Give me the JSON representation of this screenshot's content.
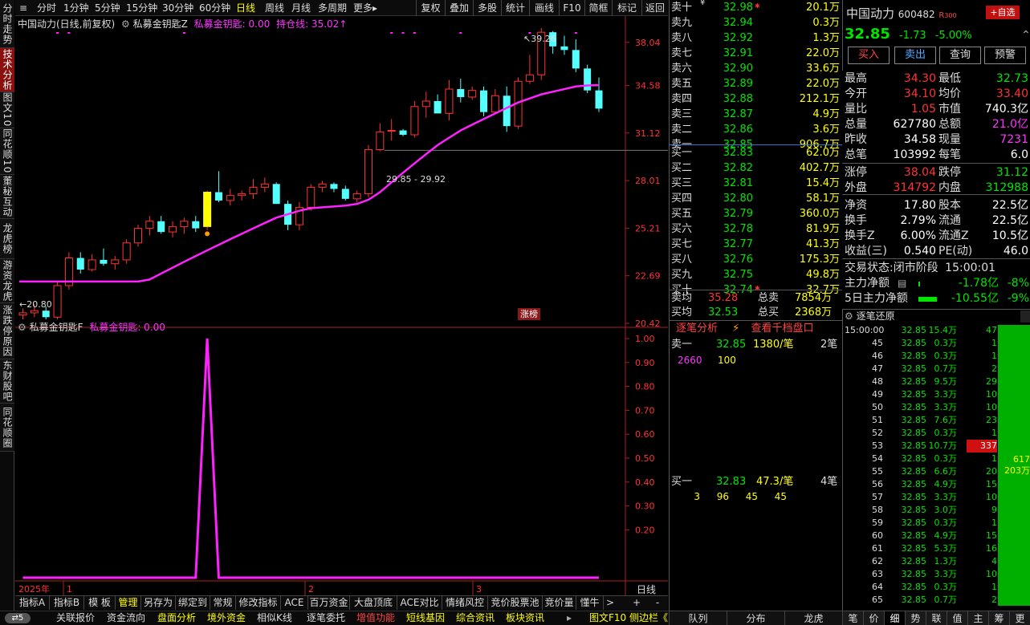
{
  "colors": {
    "up": "#ff3333",
    "down": "#54ffff",
    "ma": "#ff22ff",
    "accent": "#ffff00"
  },
  "side_tabs": [
    {
      "label": "分时走势",
      "active": false
    },
    {
      "label": "技术分析",
      "active": true
    },
    {
      "label": "图文10",
      "active": false
    },
    {
      "label": "同花顺10",
      "active": false
    },
    {
      "label": "董秘互动",
      "active": false
    },
    {
      "label": "龙虎榜",
      "active": false
    },
    {
      "label": "游资龙虎",
      "active": false
    },
    {
      "label": "涨跌停原因",
      "active": false
    },
    {
      "label": "东财股吧",
      "active": false
    },
    {
      "label": "同花顺圈",
      "active": false
    }
  ],
  "periods": [
    "分时",
    "1分钟",
    "5分钟",
    "15分钟",
    "30分钟",
    "60分钟",
    "日线",
    "周线",
    "月线",
    "多周期",
    "更多▸"
  ],
  "active_period": "日线",
  "tools": [
    "复权",
    "叠加",
    "多股",
    "统计",
    "画线",
    "F10",
    "简框",
    "标记",
    "返回"
  ],
  "chart": {
    "title": "中国动力(日线,前复权)",
    "indicator_name": "私募金钥匙Z",
    "indicator_value": "私募金钥匙: 0.00",
    "hold_line": "持仓线: 35.02↑",
    "high_label": "39.26",
    "low_label": "20.80",
    "range_label": "29.85 - 29.92",
    "zhangting_badge": "涨榜",
    "yticks": [
      "38.04",
      "34.58",
      "31.12",
      "28.01",
      "25.21",
      "22.69",
      "20.42"
    ],
    "sub_title": "私募金钥匙F",
    "sub_value": "私募金钥匙: 0.00",
    "sub_yticks": [
      "1.00",
      "0.90",
      "0.80",
      "0.70",
      "0.60",
      "0.50",
      "0.40",
      "0.30",
      "0.20"
    ],
    "xlabels": [
      "2025年",
      "1",
      "2",
      "3"
    ],
    "period_label": "日线"
  },
  "chart_data": {
    "type": "candlestick",
    "ohlc": [
      [
        20.8,
        21.1,
        20.6,
        20.9
      ],
      [
        20.9,
        21.3,
        20.7,
        21.0
      ],
      [
        21.0,
        21.2,
        20.6,
        20.7
      ],
      [
        20.7,
        22.4,
        20.6,
        22.2
      ],
      [
        22.2,
        23.9,
        22.0,
        23.6
      ],
      [
        23.6,
        23.9,
        22.8,
        23.0
      ],
      [
        23.0,
        23.8,
        22.9,
        23.5
      ],
      [
        23.5,
        24.1,
        23.2,
        23.3
      ],
      [
        23.3,
        23.7,
        23.0,
        23.5
      ],
      [
        23.5,
        24.6,
        23.3,
        24.4
      ],
      [
        24.4,
        25.4,
        24.2,
        25.2
      ],
      [
        25.2,
        25.9,
        24.8,
        25.6
      ],
      [
        25.6,
        25.9,
        24.9,
        25.0
      ],
      [
        25.0,
        25.6,
        24.7,
        25.3
      ],
      [
        25.3,
        25.8,
        24.9,
        25.6
      ],
      [
        25.6,
        25.9,
        25.0,
        25.2
      ],
      [
        25.3,
        27.4,
        25.1,
        27.3
      ],
      [
        27.3,
        28.6,
        26.7,
        26.8
      ],
      [
        26.8,
        27.5,
        26.5,
        27.1
      ],
      [
        27.1,
        27.4,
        26.8,
        27.2
      ],
      [
        27.2,
        28.1,
        26.9,
        27.6
      ],
      [
        27.6,
        28.2,
        27.3,
        27.8
      ],
      [
        27.8,
        27.9,
        26.6,
        26.6
      ],
      [
        26.6,
        26.8,
        25.1,
        25.4
      ],
      [
        25.4,
        26.7,
        25.1,
        26.4
      ],
      [
        26.4,
        27.8,
        26.2,
        27.6
      ],
      [
        27.6,
        28.0,
        27.3,
        27.8
      ],
      [
        27.8,
        27.9,
        27.3,
        27.5
      ],
      [
        27.5,
        27.7,
        26.8,
        26.9
      ],
      [
        26.9,
        27.4,
        26.7,
        27.2
      ],
      [
        27.2,
        30.3,
        27.0,
        30.0
      ],
      [
        30.0,
        31.8,
        29.9,
        31.2
      ],
      [
        31.3,
        32.1,
        30.6,
        31.3
      ],
      [
        31.3,
        31.4,
        30.9,
        31.0
      ],
      [
        31.0,
        33.4,
        30.8,
        33.0
      ],
      [
        33.0,
        34.1,
        32.2,
        33.4
      ],
      [
        33.4,
        33.9,
        32.6,
        32.5
      ],
      [
        32.5,
        35.0,
        32.0,
        34.3
      ],
      [
        34.3,
        35.1,
        33.3,
        33.7
      ],
      [
        33.7,
        34.5,
        33.5,
        34.2
      ],
      [
        34.2,
        34.5,
        32.3,
        32.6
      ],
      [
        32.6,
        34.3,
        32.5,
        33.8
      ],
      [
        33.8,
        34.5,
        31.2,
        31.6
      ],
      [
        31.6,
        35.2,
        31.4,
        34.9
      ],
      [
        34.9,
        37.0,
        34.7,
        35.4
      ],
      [
        35.4,
        39.26,
        35.0,
        38.9
      ],
      [
        38.9,
        39.0,
        37.1,
        37.7
      ],
      [
        37.7,
        38.6,
        37.0,
        37.4
      ],
      [
        37.4,
        38.3,
        35.6,
        35.9
      ],
      [
        35.9,
        36.2,
        34.0,
        34.2
      ],
      [
        34.2,
        35.2,
        32.6,
        32.85
      ]
    ],
    "ma": [
      22.4,
      22.4,
      22.4,
      22.4,
      22.4,
      22.4,
      22.4,
      22.4,
      22.4,
      22.4,
      22.4,
      22.5,
      22.8,
      23.1,
      23.4,
      23.7,
      24.0,
      24.3,
      24.6,
      24.9,
      25.2,
      25.5,
      25.8,
      26.0,
      26.2,
      26.35,
      26.4,
      26.45,
      26.5,
      26.6,
      26.85,
      27.3,
      27.9,
      28.5,
      29.1,
      29.7,
      30.3,
      30.8,
      31.3,
      31.7,
      32.1,
      32.5,
      32.9,
      33.3,
      33.6,
      33.9,
      34.1,
      34.3,
      34.5,
      34.58,
      34.6
    ],
    "signal": [
      0,
      0,
      0,
      0,
      0,
      0,
      0,
      0,
      0,
      0,
      0,
      0,
      0,
      0,
      0,
      0,
      1,
      0,
      0,
      0,
      0,
      0,
      0,
      0,
      0,
      0,
      0,
      0,
      0,
      0,
      0,
      0,
      0,
      0,
      0,
      0,
      0,
      0,
      0,
      0,
      0,
      0,
      0,
      0,
      0,
      0,
      0,
      0,
      0,
      0,
      0
    ],
    "ylim": [
      20.42,
      39.26
    ],
    "x_labels": [
      "2025年",
      "1",
      "2",
      "3"
    ]
  },
  "stock": {
    "name": "中国动力",
    "code": "600482",
    "r_tag": "R",
    "r_value": "300",
    "add_label": "+自选",
    "price": "32.85",
    "change": "-1.73",
    "pct": "-5.00%"
  },
  "actions": [
    "买入",
    "卖出",
    "查询",
    "预警"
  ],
  "sells": [
    {
      "label": "卖十",
      "tag": "¥",
      "price": "32.98",
      "vol": "20.1万",
      "star": true
    },
    {
      "label": "卖九",
      "price": "32.94",
      "vol": "0.3万"
    },
    {
      "label": "卖八",
      "price": "32.92",
      "vol": "1.3万"
    },
    {
      "label": "卖七",
      "price": "32.91",
      "vol": "22.0万"
    },
    {
      "label": "卖六",
      "price": "32.90",
      "vol": "33.6万"
    },
    {
      "label": "卖五",
      "price": "32.89",
      "vol": "22.0万"
    },
    {
      "label": "卖四",
      "price": "32.88",
      "vol": "212.1万"
    },
    {
      "label": "卖三",
      "price": "32.87",
      "vol": "4.9万"
    },
    {
      "label": "卖二",
      "price": "32.86",
      "vol": "3.6万"
    },
    {
      "label": "卖一",
      "price": "32.85",
      "vol": "906.7万"
    }
  ],
  "buys": [
    {
      "label": "买一",
      "price": "32.83",
      "vol": "62.0万"
    },
    {
      "label": "买二",
      "price": "32.82",
      "vol": "402.7万"
    },
    {
      "label": "买三",
      "price": "32.81",
      "vol": "15.4万"
    },
    {
      "label": "买四",
      "price": "32.80",
      "vol": "58.1万"
    },
    {
      "label": "买五",
      "price": "32.79",
      "vol": "360.0万"
    },
    {
      "label": "买六",
      "price": "32.78",
      "vol": "81.9万"
    },
    {
      "label": "买七",
      "price": "32.77",
      "vol": "41.3万"
    },
    {
      "label": "买八",
      "price": "32.76",
      "vol": "175.3万"
    },
    {
      "label": "买九",
      "price": "32.75",
      "vol": "49.8万"
    },
    {
      "label": "买十",
      "price": "32.74",
      "vol": "32.7万",
      "star": true
    }
  ],
  "avg": {
    "sell_label": "卖均",
    "sell_price": "35.28",
    "sell_total_label": "总卖",
    "sell_total": "7854万",
    "buy_label": "买均",
    "buy_price": "32.53",
    "buy_total_label": "总买",
    "buy_total": "2368万"
  },
  "quote": [
    {
      "k1": "最高",
      "v1": "34.30",
      "c1": "red",
      "k2": "最低",
      "v2": "32.73",
      "c2": "green"
    },
    {
      "k1": "今开",
      "v1": "34.10",
      "c1": "red",
      "k2": "均价",
      "v2": "33.40",
      "c2": "red"
    },
    {
      "k1": "量比",
      "v1": "1.05",
      "c1": "red",
      "k2": "市值",
      "v2": "740.3亿",
      "c2": "wht"
    },
    {
      "k1": "总量",
      "v1": "627780",
      "c1": "wht",
      "k2": "总额",
      "v2": "21.0亿",
      "c2": "mag"
    },
    {
      "k1": "昨收",
      "v1": "34.58",
      "c1": "wht",
      "k2": "现量",
      "v2": "7231",
      "c2": "mag"
    },
    {
      "k1": "总笔",
      "v1": "103992",
      "c1": "wht",
      "k2": "每笔",
      "v2": "6.0",
      "c2": "wht"
    },
    {
      "k1": "涨停",
      "v1": "38.04",
      "c1": "red",
      "k2": "跌停",
      "v2": "31.12",
      "c2": "green"
    },
    {
      "k1": "外盘",
      "v1": "314792",
      "c1": "red",
      "k2": "内盘",
      "v2": "312988",
      "c2": "green"
    },
    {
      "k1": "净资",
      "v1": "17.80",
      "c1": "wht",
      "k2": "股本",
      "v2": "22.5亿",
      "c2": "wht"
    },
    {
      "k1": "换手",
      "v1": "2.79%",
      "c1": "wht",
      "k2": "流通",
      "v2": "22.5亿",
      "c2": "wht"
    },
    {
      "k1": "换手Z",
      "v1": "6.00%",
      "c1": "wht",
      "k2": "流通Z",
      "v2": "10.5亿",
      "c2": "wht"
    },
    {
      "k1": "收益(三)",
      "v1": "0.540",
      "c1": "wht",
      "k2": "PE(动)",
      "v2": "46.0",
      "c2": "wht"
    }
  ],
  "trade_status": {
    "label": "交易状态:",
    "value": "闭市阶段",
    "time": "15:00:01"
  },
  "flow": [
    {
      "label": "主力净额",
      "value": "-1.78亿",
      "pct": "-8%",
      "bar": 0.03
    },
    {
      "label": "5日主力净额",
      "value": "-10.55亿",
      "pct": "-9%",
      "bar": 0.35
    }
  ],
  "zhubi": {
    "title": "逐笔分析",
    "lightning": "⚡",
    "link": "查看千档盘口",
    "sell_row": {
      "label": "卖一",
      "price": "32.85",
      "qty": "1380/笔",
      "count": "2笔"
    },
    "sell_orders": [
      "2660",
      "100"
    ],
    "buy_row": {
      "label": "买一",
      "price": "32.83",
      "qty": "47.3/笔",
      "count": "4笔"
    },
    "buy_orders": [
      "3",
      "96",
      "45",
      "45"
    ]
  },
  "ticks_title": "逐笔还原",
  "ticks": [
    {
      "t": "15:00:00",
      "p": "32.85",
      "v": "15.4万",
      "n": "47"
    },
    {
      "t": "45",
      "p": "32.85",
      "v": "0.3万",
      "n": "1"
    },
    {
      "t": "46",
      "p": "32.85",
      "v": "0.3万",
      "n": "1"
    },
    {
      "t": "47",
      "p": "32.85",
      "v": "0.7万",
      "n": "2"
    },
    {
      "t": "48",
      "p": "32.85",
      "v": "9.5万",
      "n": "29"
    },
    {
      "t": "49",
      "p": "32.85",
      "v": "3.3万",
      "n": "10"
    },
    {
      "t": "50",
      "p": "32.85",
      "v": "3.3万",
      "n": "10"
    },
    {
      "t": "51",
      "p": "32.85",
      "v": "7.6万",
      "n": "23"
    },
    {
      "t": "52",
      "p": "32.85",
      "v": "0.3万",
      "n": "1"
    },
    {
      "t": "53",
      "p": "32.85",
      "v": "10.7万",
      "n": "337",
      "highlight": true
    },
    {
      "t": "54",
      "p": "32.85",
      "v": "0.3万",
      "n": "1"
    },
    {
      "t": "55",
      "p": "32.85",
      "v": "6.6万",
      "n": "20"
    },
    {
      "t": "56",
      "p": "32.85",
      "v": "4.9万",
      "n": "15"
    },
    {
      "t": "57",
      "p": "32.85",
      "v": "3.3万",
      "n": "10"
    },
    {
      "t": "58",
      "p": "32.85",
      "v": "3.0万",
      "n": "9"
    },
    {
      "t": "59",
      "p": "32.85",
      "v": "0.3万",
      "n": "1"
    },
    {
      "t": "60",
      "p": "32.85",
      "v": "4.9万",
      "n": "15"
    },
    {
      "t": "61",
      "p": "32.85",
      "v": "5.3万",
      "n": "16"
    },
    {
      "t": "62",
      "p": "32.85",
      "v": "1.3万",
      "n": "4"
    },
    {
      "t": "63",
      "p": "32.85",
      "v": "3.3万",
      "n": "10"
    },
    {
      "t": "64",
      "p": "32.85",
      "v": "0.3万",
      "n": "1"
    },
    {
      "t": "65",
      "p": "32.85",
      "v": "0.7万",
      "n": "2"
    }
  ],
  "tick_bar": {
    "count": "617",
    "amount": "203万"
  },
  "bottom_tabs": [
    "指标A",
    "指标B",
    "模 板",
    "管理",
    "另存为",
    "绑定到",
    "常规",
    "修改指标",
    "ACE",
    "百万资金",
    "大盘顶底",
    "ACE对比",
    "情绪风控",
    "竞价股票池",
    "竞价量",
    "懂牛"
  ],
  "bottom_active": "管理",
  "bottom_right": {
    "plus": "+",
    "minus": "-",
    "arrow": ">"
  },
  "mid_tabs": [
    "队列",
    "分布",
    "龙虎"
  ],
  "right_tabs": [
    "笔",
    "价",
    "细",
    "势",
    "联",
    "值",
    "主",
    "筹",
    "更"
  ],
  "right_active": "细",
  "status_items": [
    {
      "label": "关联报价",
      "color": "#dddddd"
    },
    {
      "label": "资金流向",
      "color": "#dddddd"
    },
    {
      "label": "盘面分析",
      "color": "#ffff00"
    },
    {
      "label": "境外资金",
      "color": "#ffff00"
    },
    {
      "label": "相似K线",
      "color": "#dddddd"
    },
    {
      "label": "逐笔委托",
      "color": "#dddddd"
    },
    {
      "label": "增值功能",
      "color": "#ff4444"
    },
    {
      "label": "短线基因",
      "color": "#ffff00"
    },
    {
      "label": "综合资讯",
      "color": "#ffff00"
    },
    {
      "label": "板块资讯",
      "color": "#ffff00"
    }
  ],
  "status_right": "图文F10 侧边栏《",
  "status_badge": "5"
}
